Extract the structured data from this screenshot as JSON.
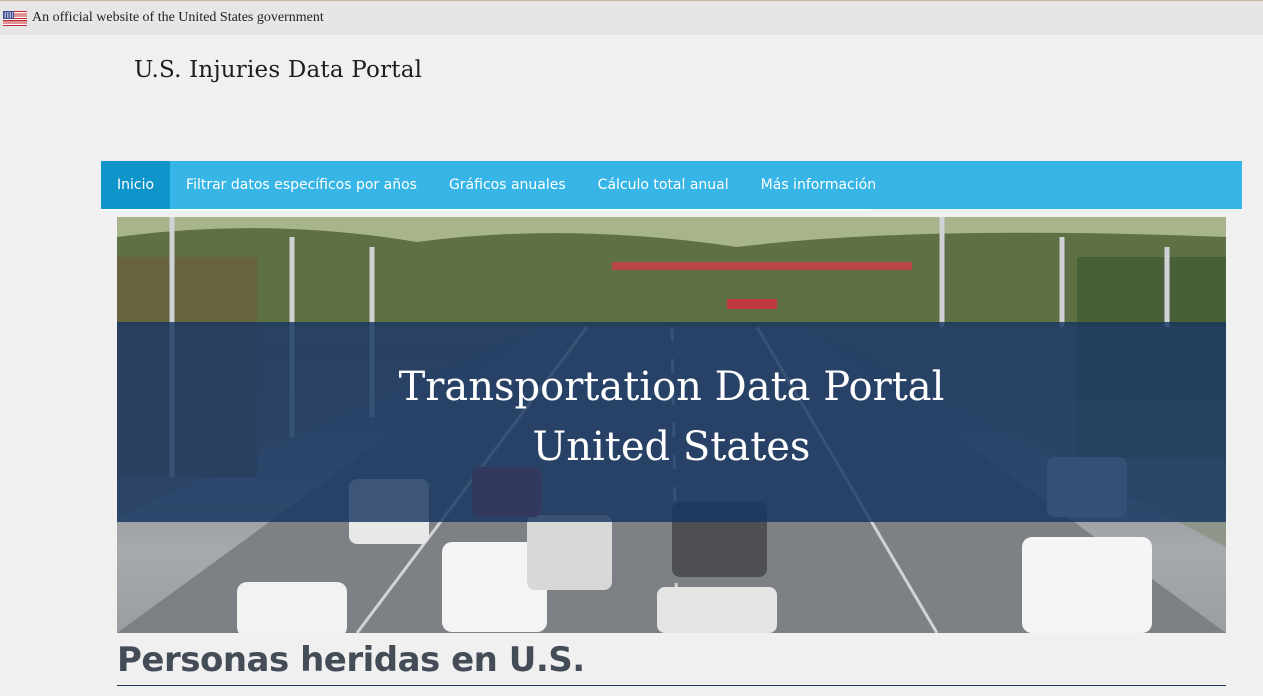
{
  "gov_banner": {
    "text": "An official website of the United States government",
    "icon": "us-flag-icon"
  },
  "site": {
    "title": "U.S. Injuries Data Portal"
  },
  "nav": {
    "items": [
      {
        "label": "Inicio",
        "active": true
      },
      {
        "label": "Filtrar datos específicos por años",
        "active": false
      },
      {
        "label": "Gráficos anuales",
        "active": false
      },
      {
        "label": "Cálculo total anual",
        "active": false
      },
      {
        "label": "Más información",
        "active": false
      }
    ],
    "color": "#37b5e6",
    "active_color": "#0f95c9"
  },
  "hero": {
    "line1": "Transportation Data Portal",
    "line2": "United States",
    "overlay_color": "#163460"
  },
  "main": {
    "heading": "Personas heridas en U.S."
  }
}
